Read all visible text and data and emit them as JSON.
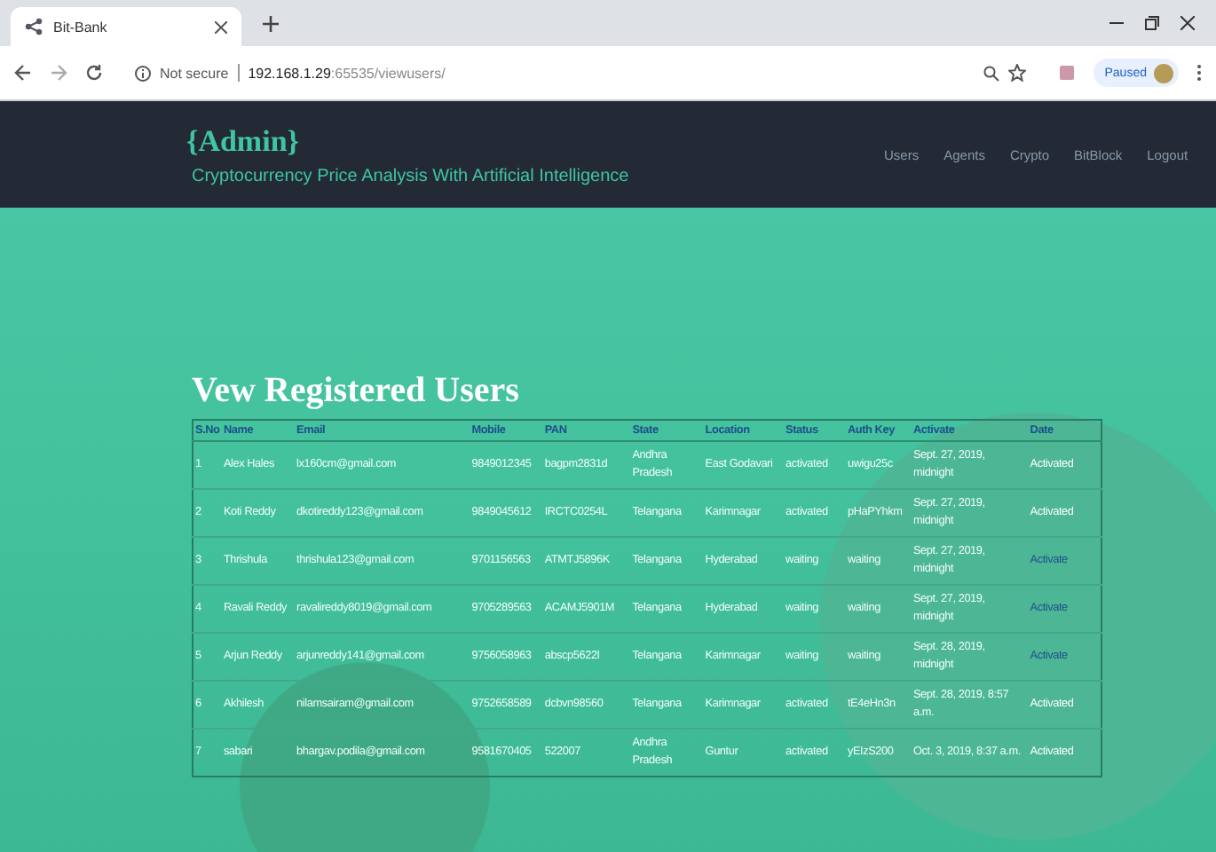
{
  "browser": {
    "tab_title": "Bit-Bank",
    "security": "Not secure",
    "url_host": "192.168.1.29",
    "url_path": ":65535/viewusers/",
    "profile": "Paused"
  },
  "header": {
    "brand": "{Admin}",
    "subtitle": "Cryptocurrency Price Analysis With Artificial Intelligence",
    "nav": [
      "Users",
      "Agents",
      "Crypto",
      "BitBlock",
      "Logout"
    ]
  },
  "page_title": "Vew Registered Users",
  "table": {
    "columns": [
      "S.No",
      "Name",
      "Email",
      "Mobile",
      "PAN",
      "State",
      "Location",
      "Status",
      "Auth Key",
      "Activate",
      "Date"
    ],
    "rows": [
      {
        "cells": [
          "1",
          "Alex Hales",
          "lx160cm@gmail.com",
          "9849012345",
          "bagpm2831d",
          "Andhra Pradesh",
          "East Godavari",
          "activated",
          "uwigu25c",
          "Sept. 27, 2019, midnight"
        ],
        "action": "Activated",
        "activated": true
      },
      {
        "cells": [
          "2",
          "Koti Reddy",
          "dkotireddy123@gmail.com",
          "9849045612",
          "IRCTC0254L",
          "Telangana",
          "Karimnagar",
          "activated",
          "pHaPYhkm",
          "Sept. 27, 2019, midnight"
        ],
        "action": "Activated",
        "activated": true
      },
      {
        "cells": [
          "3",
          "Thrishula",
          "thrishula123@gmail.com",
          "9701156563",
          "ATMTJ5896K",
          "Telangana",
          "Hyderabad",
          "waiting",
          "waiting",
          "Sept. 27, 2019, midnight"
        ],
        "action": "Activate",
        "activated": false
      },
      {
        "cells": [
          "4",
          "Ravali Reddy",
          "ravalireddy8019@gmail.com",
          "9705289563",
          "ACAMJ5901M",
          "Telangana",
          "Hyderabad",
          "waiting",
          "waiting",
          "Sept. 27, 2019, midnight"
        ],
        "action": "Activate",
        "activated": false
      },
      {
        "cells": [
          "5",
          "Arjun Reddy",
          "arjunreddy141@gmail.com",
          "9756058963",
          "abscp5622l",
          "Telangana",
          "Karimnagar",
          "waiting",
          "waiting",
          "Sept. 28, 2019, midnight"
        ],
        "action": "Activate",
        "activated": false
      },
      {
        "cells": [
          "6",
          "Akhilesh",
          "nilamsairam@gmail.com",
          "9752658589",
          "dcbvn98560",
          "Telangana",
          "Karimnagar",
          "activated",
          "tE4eHn3n",
          "Sept. 28, 2019, 8:57 a.m."
        ],
        "action": "Activated",
        "activated": true
      },
      {
        "cells": [
          "7",
          "sabari",
          "bhargav.podila@gmail.com",
          "9581670405",
          "522007",
          "Andhra Pradesh",
          "Guntur",
          "activated",
          "yEIzS200",
          "Oct. 3, 2019, 8:37 a.m."
        ],
        "action": "Activated",
        "activated": true
      }
    ]
  }
}
